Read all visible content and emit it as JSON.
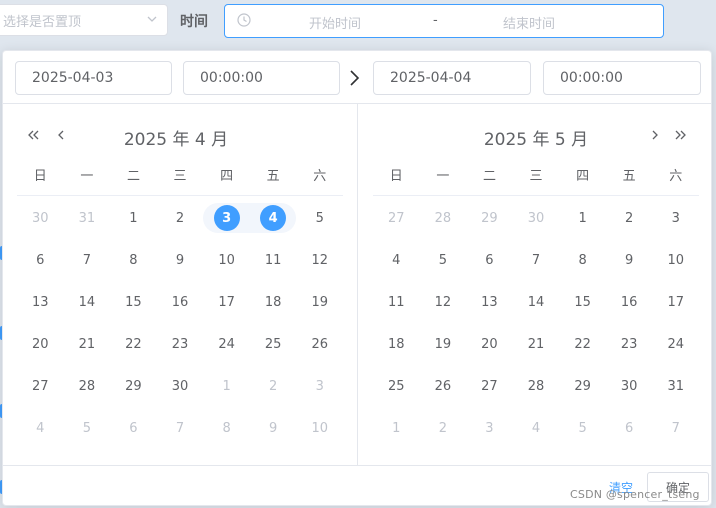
{
  "top": {
    "select_placeholder": "选择是否置顶",
    "time_label": "时间",
    "start_placeholder": "开始时间",
    "range_sep": "-",
    "end_placeholder": "结束时间"
  },
  "picker": {
    "start_date": "2025-04-03",
    "start_time": "00:00:00",
    "end_date": "2025-04-04",
    "end_time": "00:00:00",
    "weekdays": [
      "日",
      "一",
      "二",
      "三",
      "四",
      "五",
      "六"
    ],
    "left": {
      "title": "2025 年 4 月",
      "weeks": [
        [
          {
            "d": "30",
            "dim": true
          },
          {
            "d": "31",
            "dim": true
          },
          {
            "d": "1"
          },
          {
            "d": "2"
          },
          {
            "d": "3",
            "sel": true
          },
          {
            "d": "4",
            "sel": true
          },
          {
            "d": "5"
          }
        ],
        [
          {
            "d": "6"
          },
          {
            "d": "7"
          },
          {
            "d": "8"
          },
          {
            "d": "9"
          },
          {
            "d": "10"
          },
          {
            "d": "11"
          },
          {
            "d": "12"
          }
        ],
        [
          {
            "d": "13"
          },
          {
            "d": "14"
          },
          {
            "d": "15"
          },
          {
            "d": "16"
          },
          {
            "d": "17"
          },
          {
            "d": "18"
          },
          {
            "d": "19"
          }
        ],
        [
          {
            "d": "20"
          },
          {
            "d": "21"
          },
          {
            "d": "22"
          },
          {
            "d": "23"
          },
          {
            "d": "24"
          },
          {
            "d": "25"
          },
          {
            "d": "26"
          }
        ],
        [
          {
            "d": "27"
          },
          {
            "d": "28"
          },
          {
            "d": "29"
          },
          {
            "d": "30"
          },
          {
            "d": "1",
            "dim": true
          },
          {
            "d": "2",
            "dim": true
          },
          {
            "d": "3",
            "dim": true
          }
        ],
        [
          {
            "d": "4",
            "dim": true
          },
          {
            "d": "5",
            "dim": true
          },
          {
            "d": "6",
            "dim": true
          },
          {
            "d": "7",
            "dim": true
          },
          {
            "d": "8",
            "dim": true
          },
          {
            "d": "9",
            "dim": true
          },
          {
            "d": "10",
            "dim": true
          }
        ]
      ]
    },
    "right": {
      "title": "2025 年 5 月",
      "weeks": [
        [
          {
            "d": "27",
            "dim": true
          },
          {
            "d": "28",
            "dim": true
          },
          {
            "d": "29",
            "dim": true
          },
          {
            "d": "30",
            "dim": true
          },
          {
            "d": "1"
          },
          {
            "d": "2"
          },
          {
            "d": "3"
          }
        ],
        [
          {
            "d": "4"
          },
          {
            "d": "5"
          },
          {
            "d": "6"
          },
          {
            "d": "7"
          },
          {
            "d": "8"
          },
          {
            "d": "9"
          },
          {
            "d": "10"
          }
        ],
        [
          {
            "d": "11"
          },
          {
            "d": "12"
          },
          {
            "d": "13"
          },
          {
            "d": "14"
          },
          {
            "d": "15"
          },
          {
            "d": "16"
          },
          {
            "d": "17"
          }
        ],
        [
          {
            "d": "18"
          },
          {
            "d": "19"
          },
          {
            "d": "20"
          },
          {
            "d": "21"
          },
          {
            "d": "22"
          },
          {
            "d": "23"
          },
          {
            "d": "24"
          }
        ],
        [
          {
            "d": "25"
          },
          {
            "d": "26"
          },
          {
            "d": "27"
          },
          {
            "d": "28"
          },
          {
            "d": "29"
          },
          {
            "d": "30"
          },
          {
            "d": "31"
          }
        ],
        [
          {
            "d": "1",
            "dim": true
          },
          {
            "d": "2",
            "dim": true
          },
          {
            "d": "3",
            "dim": true
          },
          {
            "d": "4",
            "dim": true
          },
          {
            "d": "5",
            "dim": true
          },
          {
            "d": "6",
            "dim": true
          },
          {
            "d": "7",
            "dim": true
          }
        ]
      ]
    },
    "clear_label": "清空",
    "ok_label": "确定"
  },
  "watermark": "CSDN @spencer_tseng",
  "colors": {
    "accent": "#409eff",
    "range_bg": "#f2f6fc",
    "text": "#606266",
    "muted": "#c0c4cc"
  },
  "icons": {
    "select_arrow": "chevron-down-icon",
    "range_input": "clock-icon",
    "separator": "chevron-right-icon",
    "prev_year": "double-chevron-left-icon",
    "prev_month": "chevron-left-icon",
    "next_month": "chevron-right-icon",
    "next_year": "double-chevron-right-icon"
  }
}
